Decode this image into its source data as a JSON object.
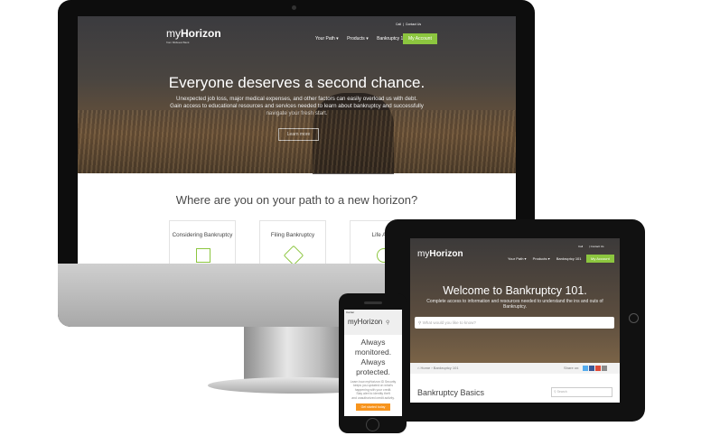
{
  "desktop": {
    "logo_prefix": "my",
    "logo_brand": "Horizon",
    "logo_tagline": "from Midwest Bank",
    "util_links": [
      "Call",
      "Contact Us"
    ],
    "nav": [
      "Your Path ▾",
      "Products ▾",
      "Bankruptcy 101"
    ],
    "account_label": "My Account",
    "hero_title": "Everyone deserves a second chance.",
    "hero_lines": [
      "Unexpected job loss, major medical expenses, and other factors can easily overload us with debt.",
      "Gain access to educational resources and services needed to learn about bankruptcy and successfully",
      "navigate your fresh start."
    ],
    "learn_more": "Learn more",
    "section_title": "Where are you on your path to a new horizon?",
    "cards": [
      "Considering Bankruptcy",
      "Filing Bankruptcy",
      "Life After"
    ]
  },
  "tablet": {
    "logo_prefix": "my",
    "logo_brand": "Horizon",
    "util_links": [
      "Call",
      "Contact Us"
    ],
    "nav": [
      "Your Path ▾",
      "Products ▾",
      "Bankruptcy 101"
    ],
    "account_label": "My Account",
    "title": "Welcome to Bankruptcy 101.",
    "subtitle_lines": [
      "Complete access to information and resources needed to understand the ins and outs of",
      "Bankruptcy."
    ],
    "search_placeholder": "What would you like to know?",
    "breadcrumb": "Home  ›  Bankruptcy 101",
    "share_label": "Share on:",
    "section_heading": "Bankruptcy Basics",
    "sidebar_search": "Search"
  },
  "phone": {
    "status": "Carrier",
    "logo": "myHorizon",
    "headline_lines": [
      "Always",
      "monitored.",
      "Always",
      "protected."
    ],
    "body_lines": [
      "Learn how myHorizon ID Security",
      "keeps you updated on what's",
      "happening with your credit.",
      "Stay alert to identity theft",
      "and unauthorized credit activity."
    ],
    "cta": "Get started today"
  },
  "colors": {
    "accent_green": "#8cc63f",
    "accent_orange": "#f7941d"
  }
}
